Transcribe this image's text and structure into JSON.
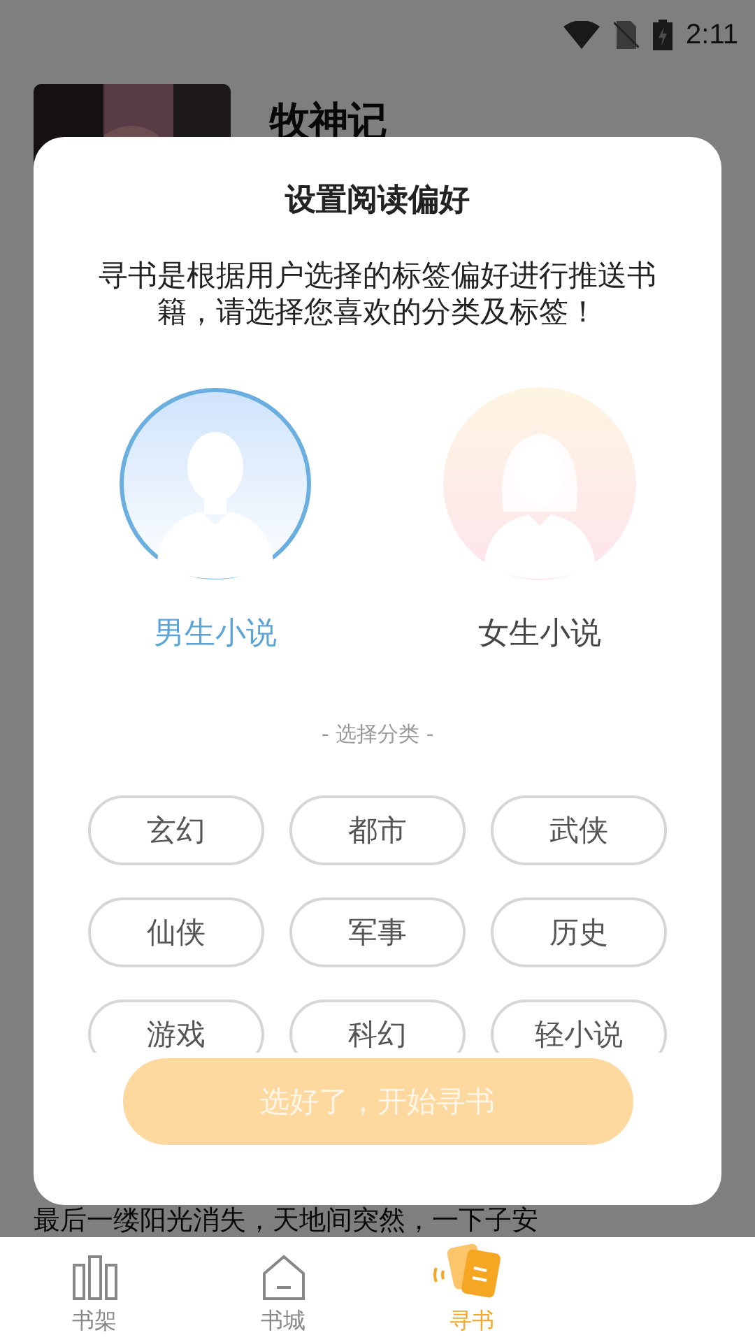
{
  "status_bar": {
    "time": "2:11"
  },
  "book": {
    "title": "牧神记",
    "excerpt": "最后一缕阳光消失，天地间突然，一下子安"
  },
  "dialog": {
    "title": "设置阅读偏好",
    "description": "寻书是根据用户选择的标签偏好进行推送书籍，请选择您喜欢的分类及标签！",
    "genders": [
      {
        "label": "男生小说",
        "kind": "male",
        "selected": true
      },
      {
        "label": "女生小说",
        "kind": "female",
        "selected": false
      }
    ],
    "section_label": "- 选择分类 -",
    "categories": [
      {
        "label": "玄幻",
        "selected": false
      },
      {
        "label": "都市",
        "selected": false
      },
      {
        "label": "武侠",
        "selected": false
      },
      {
        "label": "仙侠",
        "selected": false
      },
      {
        "label": "军事",
        "selected": false
      },
      {
        "label": "历史",
        "selected": false
      },
      {
        "label": "游戏",
        "selected": false
      },
      {
        "label": "科幻",
        "selected": false
      },
      {
        "label": "轻小说",
        "selected": false
      }
    ],
    "confirm": {
      "label": "选好了，开始寻书",
      "disabled": true
    }
  },
  "nav": [
    {
      "label": "书架",
      "kind": "shelf",
      "selected": false
    },
    {
      "label": "书城",
      "kind": "store",
      "selected": false
    },
    {
      "label": "寻书",
      "kind": "find",
      "selected": true
    }
  ]
}
